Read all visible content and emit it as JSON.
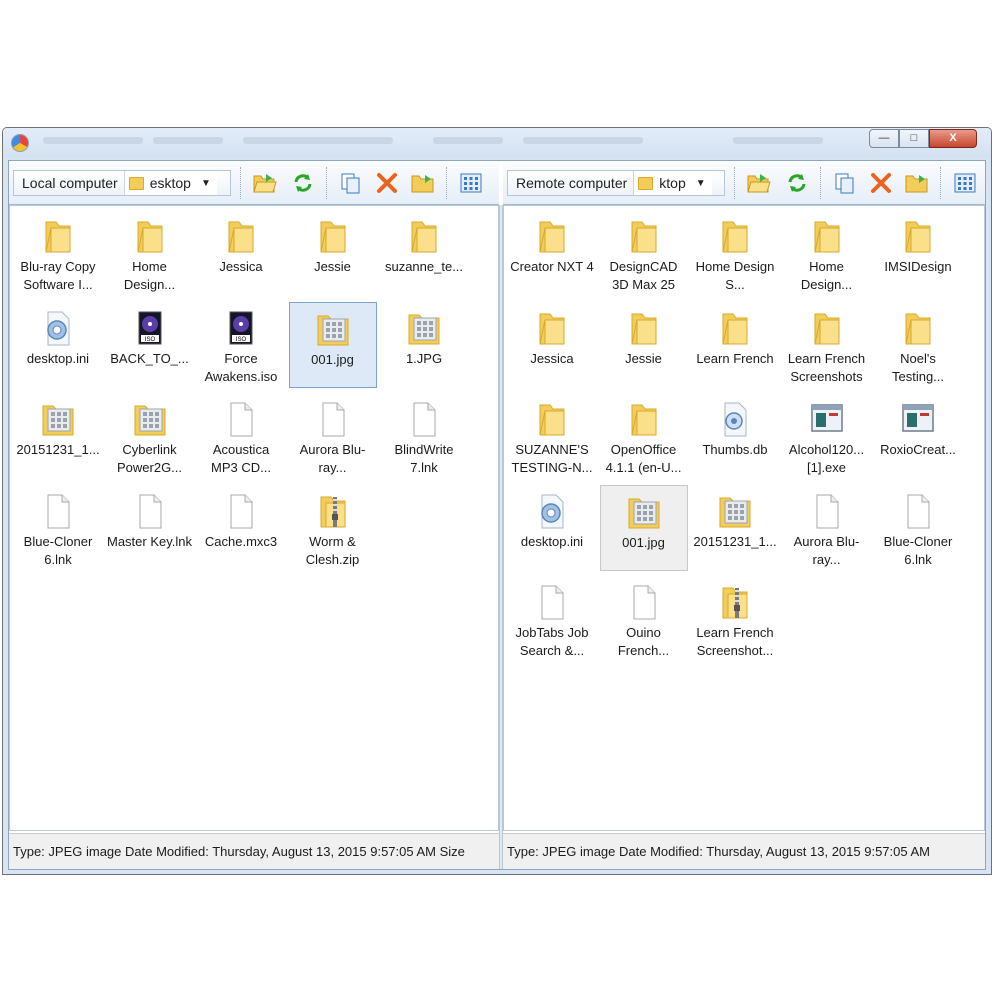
{
  "window": {
    "controls": {
      "minimize": "—",
      "maximize": "□",
      "close": "X"
    }
  },
  "left": {
    "label": "Local computer",
    "location": "esktop",
    "status": "Type: JPEG image Date Modified: Thursday, August 13, 2015 9:57:05 AM Size",
    "items": [
      {
        "label": "Blu-ray Copy Software I...",
        "icon": "folder"
      },
      {
        "label": "Home Design...",
        "icon": "folder"
      },
      {
        "label": "Jessica",
        "icon": "folder"
      },
      {
        "label": "Jessie",
        "icon": "folder"
      },
      {
        "label": "suzanne_te...",
        "icon": "folder"
      },
      {
        "label": "desktop.ini",
        "icon": "settings-file"
      },
      {
        "label": "BACK_TO_...",
        "icon": "iso"
      },
      {
        "label": "Force Awakens.iso",
        "icon": "iso"
      },
      {
        "label": "001.jpg",
        "icon": "image",
        "selected": true
      },
      {
        "label": "1.JPG",
        "icon": "image"
      },
      {
        "label": "20151231_1...",
        "icon": "image"
      },
      {
        "label": "Cyberlink Power2G...",
        "icon": "image"
      },
      {
        "label": "Acoustica MP3 CD...",
        "icon": "file"
      },
      {
        "label": "Aurora Blu-ray...",
        "icon": "file"
      },
      {
        "label": "BlindWrite 7.lnk",
        "icon": "file"
      },
      {
        "label": "Blue-Cloner 6.lnk",
        "icon": "file"
      },
      {
        "label": "Master Key.lnk",
        "icon": "file"
      },
      {
        "label": "Cache.mxc3",
        "icon": "file"
      },
      {
        "label": "Worm & Clesh.zip",
        "icon": "zip"
      }
    ]
  },
  "right": {
    "label": "Remote computer",
    "location": "ktop",
    "status": "Type: JPEG image Date Modified: Thursday, August 13, 2015 9:57:05 AM",
    "items": [
      {
        "label": "Creator NXT 4",
        "icon": "folder"
      },
      {
        "label": "DesignCAD 3D Max 25",
        "icon": "folder"
      },
      {
        "label": "Home Design S...",
        "icon": "folder"
      },
      {
        "label": "Home Design...",
        "icon": "folder"
      },
      {
        "label": "IMSIDesign",
        "icon": "folder"
      },
      {
        "label": "Jessica",
        "icon": "folder"
      },
      {
        "label": "Jessie",
        "icon": "folder"
      },
      {
        "label": "Learn French",
        "icon": "folder"
      },
      {
        "label": "Learn French Screenshots",
        "icon": "folder"
      },
      {
        "label": "Noel's Testing...",
        "icon": "folder"
      },
      {
        "label": "SUZANNE'S TESTING-N...",
        "icon": "folder"
      },
      {
        "label": "OpenOffice 4.1.1 (en-U...",
        "icon": "folder"
      },
      {
        "label": "Thumbs.db",
        "icon": "db"
      },
      {
        "label": "Alcohol120... [1].exe",
        "icon": "exe"
      },
      {
        "label": "RoxioCreat...",
        "icon": "exe"
      },
      {
        "label": "desktop.ini",
        "icon": "settings-file"
      },
      {
        "label": "001.jpg",
        "icon": "image",
        "selected": true
      },
      {
        "label": "20151231_1...",
        "icon": "image"
      },
      {
        "label": "Aurora Blu-ray...",
        "icon": "file"
      },
      {
        "label": "Blue-Cloner 6.lnk",
        "icon": "file"
      },
      {
        "label": "JobTabs Job Search &...",
        "icon": "file"
      },
      {
        "label": "Ouino French...",
        "icon": "file"
      },
      {
        "label": "Learn French Screenshot...",
        "icon": "zip"
      }
    ]
  },
  "colors": {
    "folder": "#f3cd59",
    "folder_edge": "#d9a92c",
    "selection": "#dde9f7",
    "selection_border": "#7da2ce"
  }
}
